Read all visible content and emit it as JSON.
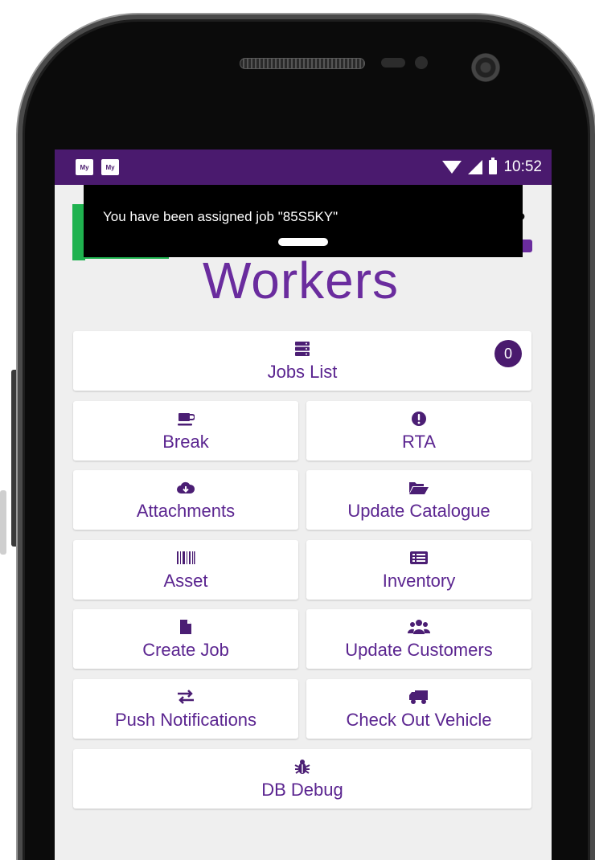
{
  "status_bar": {
    "notification_icons": [
      "My",
      "My"
    ],
    "time": "10:52"
  },
  "toast": {
    "message": "You have been assigned job \"85S5KY\""
  },
  "app": {
    "title": "Workers",
    "brand_color": "#6a2c9e",
    "status_bar_color": "#4a1a6e",
    "logo_accent_color": "#1fb24f"
  },
  "menu": {
    "jobs_list": {
      "label": "Jobs List",
      "icon": "server-icon",
      "badge": "0"
    },
    "break": {
      "label": "Break",
      "icon": "coffee-icon"
    },
    "rta": {
      "label": "RTA",
      "icon": "exclamation-circle-icon"
    },
    "attachments": {
      "label": "Attachments",
      "icon": "cloud-download-icon"
    },
    "update_catalogue": {
      "label": "Update Catalogue",
      "icon": "folder-open-icon"
    },
    "asset": {
      "label": "Asset",
      "icon": "barcode-icon"
    },
    "inventory": {
      "label": "Inventory",
      "icon": "list-alt-icon"
    },
    "create_job": {
      "label": "Create Job",
      "icon": "file-icon"
    },
    "update_customers": {
      "label": "Update Customers",
      "icon": "users-icon"
    },
    "push_notifications": {
      "label": "Push Notifications",
      "icon": "exchange-icon"
    },
    "check_out_vehicle": {
      "label": "Check Out Vehicle",
      "icon": "truck-icon"
    },
    "db_debug": {
      "label": "DB Debug",
      "icon": "bug-icon"
    }
  }
}
